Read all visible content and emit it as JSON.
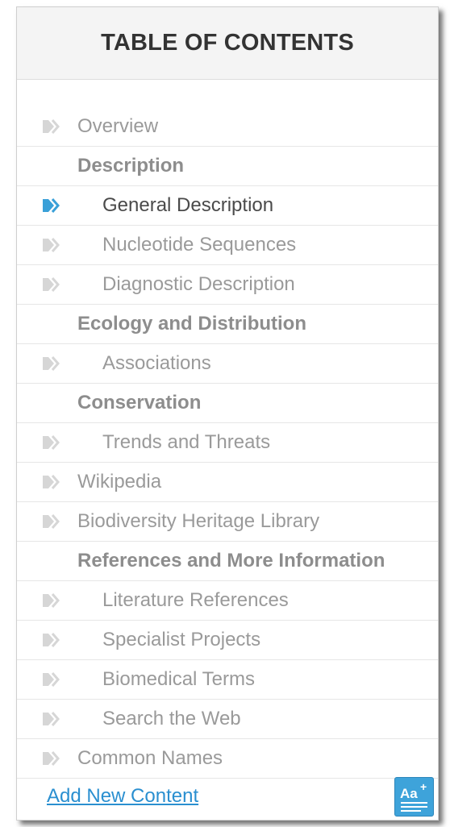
{
  "toc": {
    "title": "TABLE OF CONTENTS",
    "items": [
      {
        "label": "Overview",
        "kind": "link",
        "level": 1,
        "active": false
      },
      {
        "label": "Description",
        "kind": "section",
        "level": 1,
        "active": false
      },
      {
        "label": "General Description",
        "kind": "link",
        "level": 2,
        "active": true
      },
      {
        "label": "Nucleotide Sequences",
        "kind": "link",
        "level": 2,
        "active": false
      },
      {
        "label": "Diagnostic Description",
        "kind": "link",
        "level": 2,
        "active": false
      },
      {
        "label": "Ecology and Distribution",
        "kind": "section",
        "level": 1,
        "active": false
      },
      {
        "label": "Associations",
        "kind": "link",
        "level": 2,
        "active": false
      },
      {
        "label": "Conservation",
        "kind": "section",
        "level": 1,
        "active": false
      },
      {
        "label": "Trends and Threats",
        "kind": "link",
        "level": 2,
        "active": false
      },
      {
        "label": "Wikipedia",
        "kind": "link",
        "level": 1,
        "active": false
      },
      {
        "label": "Biodiversity Heritage Library",
        "kind": "link",
        "level": 1,
        "active": false
      },
      {
        "label": "References and More Information",
        "kind": "section",
        "level": 1,
        "active": false
      },
      {
        "label": "Literature References",
        "kind": "link",
        "level": 2,
        "active": false
      },
      {
        "label": "Specialist Projects",
        "kind": "link",
        "level": 2,
        "active": false
      },
      {
        "label": "Biomedical Terms",
        "kind": "link",
        "level": 2,
        "active": false
      },
      {
        "label": "Search the Web",
        "kind": "link",
        "level": 2,
        "active": false
      },
      {
        "label": "Common Names",
        "kind": "link",
        "level": 1,
        "active": false
      }
    ]
  },
  "footer": {
    "add_link": "Add New Content",
    "font_button_icon": "font-size-icon",
    "font_button_text": "Aa+"
  },
  "colors": {
    "active_arrow": "#3aa0d8",
    "inactive_arrow": "#d6d6d6",
    "link": "#2a8fd0"
  }
}
